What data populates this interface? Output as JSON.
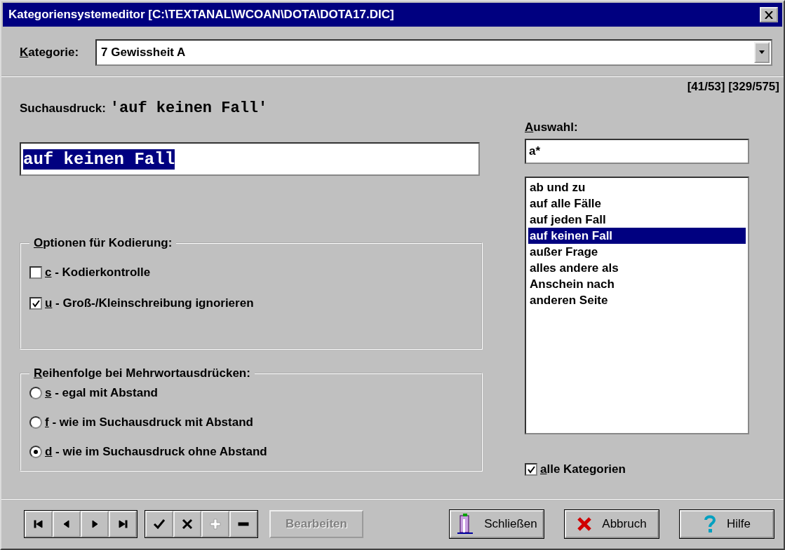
{
  "window": {
    "title": "Kategoriensystemeditor [C:\\TEXTANAL\\WCOAN\\DOTA\\DOTA17.DIC]"
  },
  "category": {
    "label": "Kategorie:",
    "value": "7 Gewissheit A"
  },
  "counter": "[41/53] [329/575]",
  "search": {
    "label": "Suchausdruck:",
    "expression": "'auf keinen Fall'"
  },
  "edit_field": {
    "value": "auf keinen Fall",
    "text_selected": true
  },
  "selection": {
    "label": "Auswahl:",
    "filter": "a*",
    "items": [
      {
        "label": "ab und zu",
        "selected": false
      },
      {
        "label": "auf alle Fälle",
        "selected": false
      },
      {
        "label": "auf jeden Fall",
        "selected": false
      },
      {
        "label": "auf keinen Fall",
        "selected": true
      },
      {
        "label": "außer Frage",
        "selected": false
      },
      {
        "label": "alles andere als",
        "selected": false
      },
      {
        "label": "Anschein nach",
        "selected": false
      },
      {
        "label": "anderen Seite",
        "selected": false
      }
    ]
  },
  "coding_options": {
    "title": "Optionen für Kodierung:",
    "items": [
      {
        "label": "c - Kodierkontrolle",
        "checked": false
      },
      {
        "label": "u - Groß-/Kleinschreibung ignorieren",
        "checked": true
      }
    ]
  },
  "word_order": {
    "title": "Reihenfolge bei Mehrwortausdrücken:",
    "items": [
      {
        "label": "s - egal mit Abstand",
        "selected": false
      },
      {
        "label": "f - wie im Suchausdruck mit Abstand",
        "selected": false
      },
      {
        "label": "d - wie im Suchausdruck ohne Abstand",
        "selected": true
      }
    ]
  },
  "all_categories": {
    "label": "alle Kategorien",
    "checked": true
  },
  "nav_buttons": [
    {
      "kind": "first",
      "disabled": false
    },
    {
      "kind": "prev",
      "disabled": false
    },
    {
      "kind": "next",
      "disabled": false
    },
    {
      "kind": "last",
      "disabled": false
    }
  ],
  "edit_buttons": [
    {
      "kind": "accept",
      "disabled": false
    },
    {
      "kind": "reject",
      "disabled": false
    },
    {
      "kind": "add",
      "disabled": true
    },
    {
      "kind": "remove",
      "disabled": false
    }
  ],
  "edit_button": {
    "label": "Bearbeiten",
    "disabled": true
  },
  "action_buttons": [
    {
      "kind": "close",
      "label": "Schließen"
    },
    {
      "kind": "cancel",
      "label": "Abbruch"
    },
    {
      "kind": "help",
      "label": "Hilfe"
    }
  ]
}
